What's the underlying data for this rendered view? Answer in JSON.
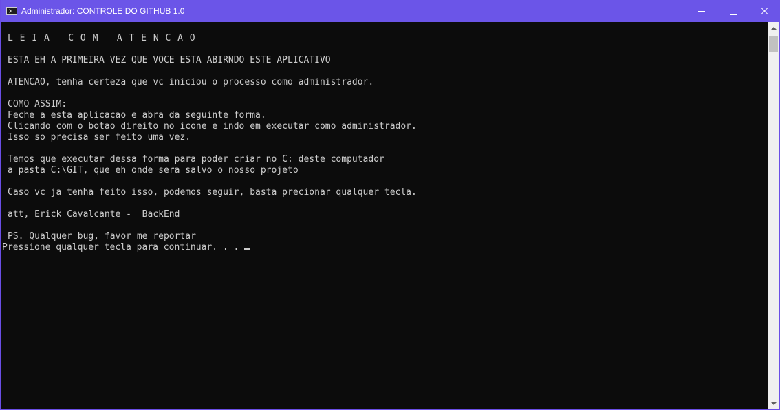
{
  "window": {
    "title": "Administrador:  CONTROLE DO GITHUB 1.0",
    "accent_color": "#6b55e8",
    "icon": "console-icon",
    "buttons": {
      "minimize_icon": "minimize-icon",
      "maximize_icon": "maximize-icon",
      "close_icon": "close-icon"
    }
  },
  "console": {
    "background": "#0c0c0c",
    "foreground": "#cccccc",
    "lines": [
      "",
      "L E I A   C O M   A T E N C A O",
      "",
      "ESTA EH A PRIMEIRA VEZ QUE VOCE ESTA ABIRNDO ESTE APLICATIVO",
      "",
      "ATENCAO, tenha certeza que vc iniciou o processo como administrador.",
      "",
      "COMO ASSIM:",
      "Feche a esta aplicacao e abra da seguinte forma.",
      "Clicando com o botao direito no icone e indo em executar como administrador.",
      "Isso so precisa ser feito uma vez.",
      "",
      "Temos que executar dessa forma para poder criar no C: deste computador",
      "a pasta C:\\GIT, que eh onde sera salvo o nosso projeto",
      "",
      "Caso vc ja tenha feito isso, podemos seguir, basta precionar qualquer tecla.",
      "",
      "att, Erick Cavalcante -  BackEnd",
      "",
      "PS. Qualquer bug, favor me reportar"
    ],
    "prompt_line": "Pressione qualquer tecla para continuar. . . "
  }
}
